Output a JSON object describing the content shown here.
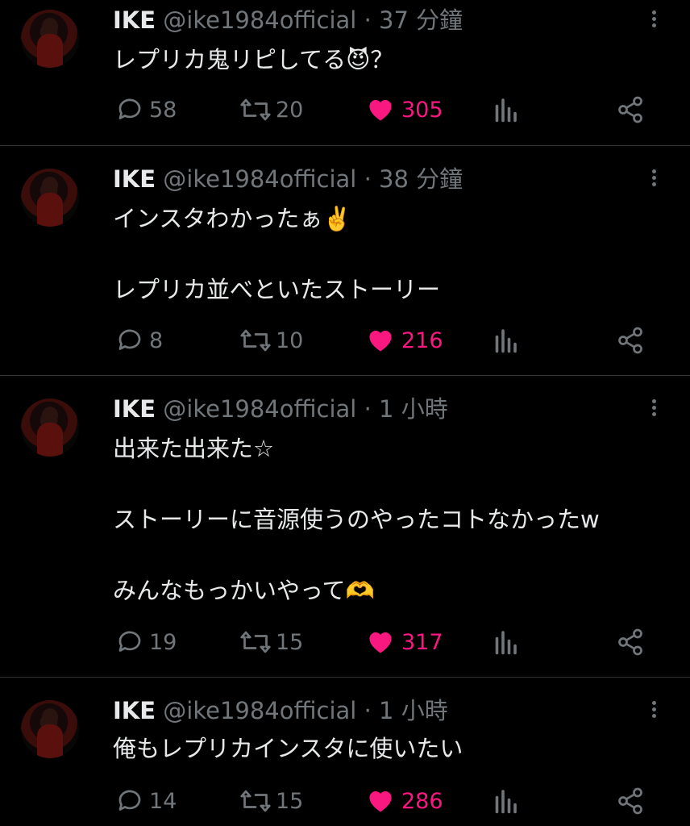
{
  "tweets": [
    {
      "author": "IKE",
      "handle": "@ike1984official",
      "time": "· 37 分鐘",
      "text": "レプリカ鬼リピしてる😈？",
      "replies": "58",
      "retweets": "20",
      "likes": "305"
    },
    {
      "author": "IKE",
      "handle": "@ike1984official",
      "time": "· 38 分鐘",
      "text": "インスタわかったぁ✌️\n\nレプリカ並べといたストーリー",
      "replies": "8",
      "retweets": "10",
      "likes": "216"
    },
    {
      "author": "IKE",
      "handle": "@ike1984official",
      "time": "· 1 小時",
      "text": "出来た出来た☆\n\nストーリーに音源使うのやったコトなかったw\n\nみんなもっかいやって🫶",
      "replies": "19",
      "retweets": "15",
      "likes": "317"
    },
    {
      "author": "IKE",
      "handle": "@ike1984official",
      "time": "· 1 小時",
      "text": "俺もレプリカインスタに使いたい",
      "replies": "14",
      "retweets": "15",
      "likes": "286"
    }
  ],
  "colors": {
    "like": "#f91880",
    "muted": "#71767b",
    "text": "#e7e9ea",
    "divider": "#2f3336"
  },
  "icons": [
    "more-icon",
    "reply-icon",
    "retweet-icon",
    "heart-icon",
    "views-icon",
    "share-icon"
  ]
}
